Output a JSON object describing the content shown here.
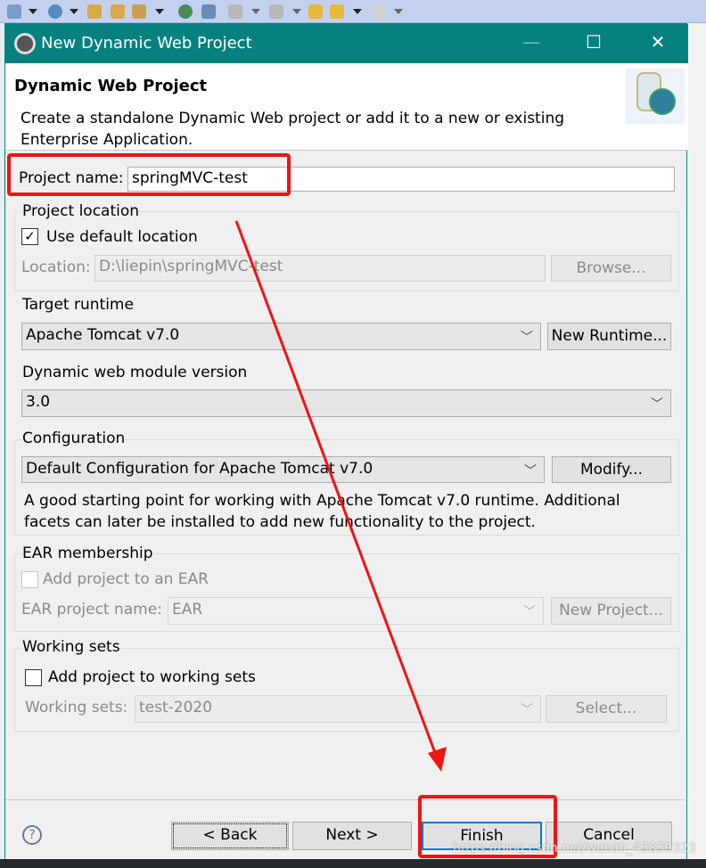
{
  "window": {
    "title": "New Dynamic Web Project"
  },
  "header": {
    "title": "Dynamic Web Project",
    "description": "Create a standalone Dynamic Web project or add it to a new or existing Enterprise Application."
  },
  "project_name": {
    "label": "Project name:",
    "value": "springMVC-test"
  },
  "project_location": {
    "group": "Project location",
    "use_default": "Use default location",
    "use_default_checked": true,
    "location_label": "Location:",
    "location_value": "D:\\liepin\\springMVC-test",
    "browse": "Browse..."
  },
  "target_runtime": {
    "group": "Target runtime",
    "value": "Apache Tomcat v7.0",
    "new_runtime": "New Runtime..."
  },
  "module_version": {
    "group": "Dynamic web module version",
    "value": "3.0"
  },
  "configuration": {
    "group": "Configuration",
    "value": "Default Configuration for Apache Tomcat v7.0",
    "modify": "Modify...",
    "description": "A good starting point for working with Apache Tomcat v7.0 runtime. Additional facets can later be installed to add new functionality to the project."
  },
  "ear": {
    "group": "EAR membership",
    "add_label": "Add project to an EAR",
    "checked": false,
    "name_label": "EAR project name:",
    "name_value": "EAR",
    "new_project": "New Project..."
  },
  "working_sets": {
    "group": "Working sets",
    "add_label": "Add project to working sets",
    "checked": false,
    "sets_label": "Working sets:",
    "sets_value": "test-2020",
    "select": "Select..."
  },
  "buttons": {
    "back": "< Back",
    "next": "Next >",
    "finish": "Finish",
    "cancel": "Cancel"
  },
  "watermark": "https://blog.csdn.net/weixin_43839323",
  "colors": {
    "titlebar": "#06817f",
    "annotation": "#f01414",
    "default_button_border": "#0078d7"
  }
}
